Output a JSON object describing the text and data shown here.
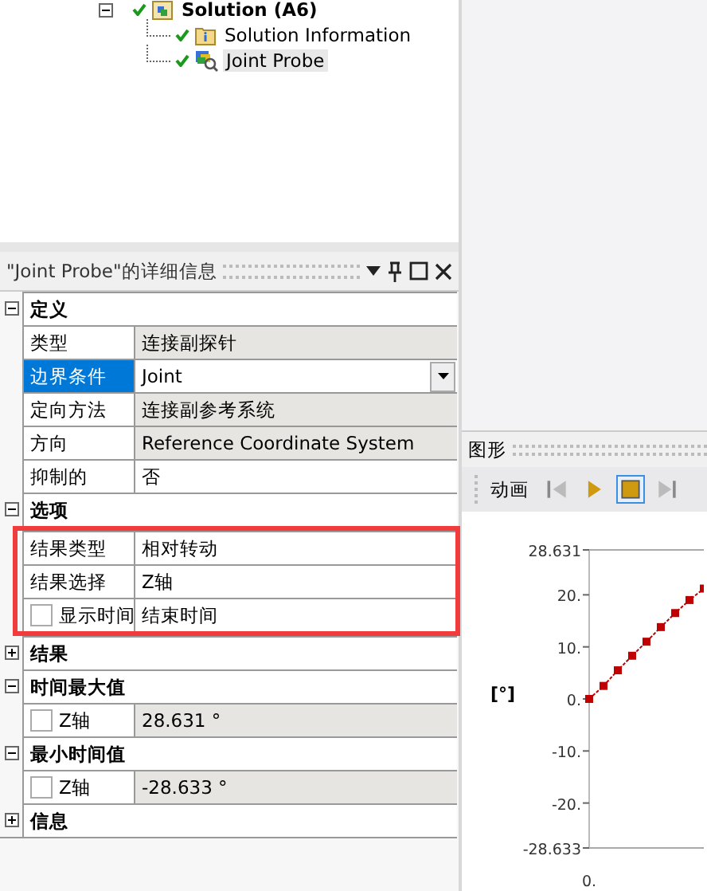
{
  "tree": {
    "label": "Solution (A6)",
    "expanded": true,
    "children": [
      {
        "label": "Solution Information",
        "kind": "info",
        "selected": false
      },
      {
        "label": "Joint Probe",
        "kind": "probe",
        "selected": true
      }
    ]
  },
  "details": {
    "title": "\"Joint Probe\"的详细信息",
    "groups": [
      {
        "label": "定义",
        "expanded": true,
        "highlighted": false,
        "rows": [
          {
            "kind": "text",
            "key": "类型",
            "value": "连接副探针",
            "readonly": true,
            "selected": false
          },
          {
            "kind": "dropdown",
            "key": "边界条件",
            "value": "Joint",
            "readonly": false,
            "selected": true
          },
          {
            "kind": "text",
            "key": "定向方法",
            "value": "连接副参考系统",
            "readonly": true,
            "selected": false
          },
          {
            "kind": "text",
            "key": "方向",
            "value": "Reference Coordinate System",
            "readonly": true,
            "selected": false
          },
          {
            "kind": "text",
            "key": "抑制的",
            "value": "否",
            "readonly": false,
            "selected": false
          }
        ]
      },
      {
        "label": "选项",
        "expanded": true,
        "highlighted": true,
        "rows": [
          {
            "kind": "text",
            "key": "结果类型",
            "value": "相对转动",
            "readonly": false,
            "selected": false
          },
          {
            "kind": "text",
            "key": "结果选择",
            "value": "Z轴",
            "readonly": false,
            "selected": false
          },
          {
            "kind": "checkbox",
            "key": "显示时间",
            "value": "结束时间",
            "checked": false,
            "readonly": false,
            "selected": false
          }
        ]
      },
      {
        "label": "结果",
        "expanded": false,
        "highlighted": false
      },
      {
        "label": "时间最大值",
        "expanded": true,
        "highlighted": false,
        "rows": [
          {
            "kind": "checkbox",
            "key": "Z轴",
            "value": "28.631 °",
            "checked": false,
            "readonly": true,
            "selected": false
          }
        ]
      },
      {
        "label": "最小时间值",
        "expanded": true,
        "highlighted": false,
        "rows": [
          {
            "kind": "checkbox",
            "key": "Z轴",
            "value": "-28.633 °",
            "checked": false,
            "readonly": true,
            "selected": false
          }
        ]
      },
      {
        "label": "信息",
        "expanded": false,
        "highlighted": false
      }
    ]
  },
  "graph": {
    "title": "图形",
    "toolbar_label": "动画",
    "buttons": [
      {
        "kind": "previous",
        "disabled": true,
        "selected": false
      },
      {
        "kind": "play",
        "disabled": false,
        "selected": false
      },
      {
        "kind": "stop",
        "disabled": false,
        "selected": true
      },
      {
        "kind": "next",
        "disabled": true,
        "selected": false
      }
    ],
    "chart_data": {
      "type": "line",
      "ylabel": "[°]",
      "annotations": [
        "0."
      ],
      "ylim": [
        -28.633,
        28.631
      ],
      "yticks": [
        {
          "value": 28.631,
          "label": "28.631"
        },
        {
          "value": 20,
          "label": "20."
        },
        {
          "value": 10,
          "label": "10."
        },
        {
          "value": 0,
          "label": "0."
        },
        {
          "value": -10,
          "label": "-10."
        },
        {
          "value": -20,
          "label": "-20."
        },
        {
          "value": -28.633,
          "label": "-28.633"
        }
      ],
      "series": [
        {
          "color": "#c00000",
          "line_style": "dashed",
          "marker": "square",
          "values": [
            0,
            2.5,
            5.5,
            8.3,
            11,
            13.8,
            16.5,
            19,
            21.2
          ]
        }
      ]
    }
  }
}
